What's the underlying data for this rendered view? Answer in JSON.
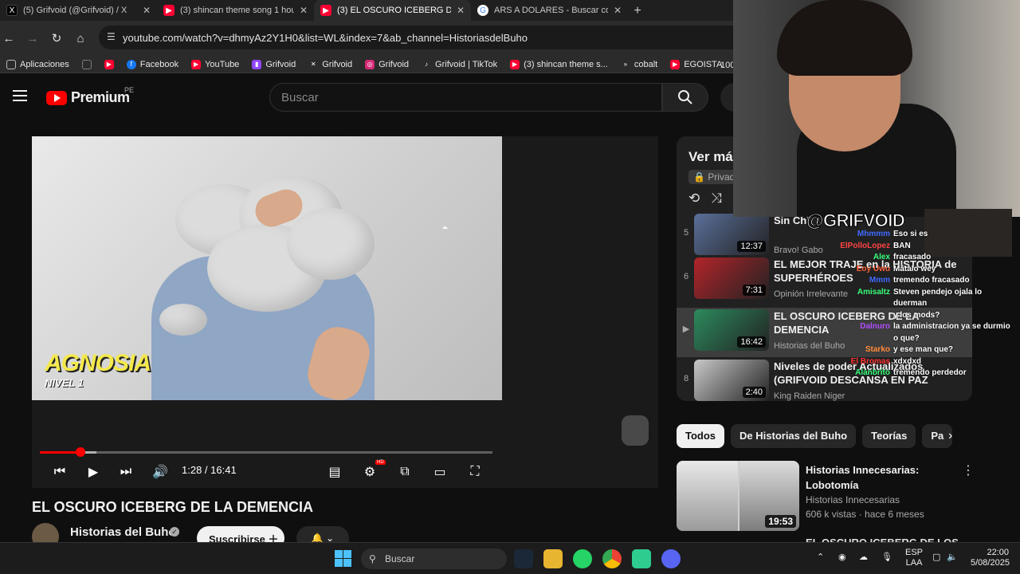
{
  "tabs": [
    {
      "title": "(5) Grifvoid (@Grifvoid) / X",
      "fav": "x-icon",
      "color": "#000000"
    },
    {
      "title": "(3) shincan theme song 1 hour",
      "fav": "youtube-icon",
      "color": "#ff0033"
    },
    {
      "title": "(3) EL OSCURO ICEBERG DE LA",
      "fav": "youtube-icon",
      "color": "#ff0033"
    },
    {
      "title": "ARS A DOLARES - Buscar con G",
      "fav": "google-icon",
      "color": "#4285f4"
    }
  ],
  "address": {
    "url": "youtube.com/watch?v=dhmyAz2Y1H0&list=WL&index=7&ab_channel=HistoriasdelBuho"
  },
  "bookmarks": [
    {
      "label": "Aplicaciones"
    },
    {
      "label": "Facebook"
    },
    {
      "label": "YouTube"
    },
    {
      "label": "Grifvoid"
    },
    {
      "label": "Grifvoid"
    },
    {
      "label": "Grifvoid"
    },
    {
      "label": "Grifvoid | TikTok"
    },
    {
      "label": "(3) shincan theme s..."
    },
    {
      "label": "cobalt"
    },
    {
      "label": "EGOISTA"
    }
  ],
  "zoom": "100",
  "header": {
    "logo": "Premium",
    "region": "PE",
    "search_placeholder": "Buscar"
  },
  "player": {
    "overlay_title": "AGNOSIA",
    "overlay_level": "NIVEL 1",
    "time": "1:28 / 16:41",
    "played_fraction": 0.089,
    "buffered_fraction": 0.125,
    "hd": "HD"
  },
  "video": {
    "title": "EL OSCURO ICEBERG DE LA DEMENCIA",
    "channel": "Historias del Buho",
    "subscribe": "Suscribirse"
  },
  "playlist": {
    "header": "Ver má",
    "privacy": "Privad",
    "items": [
      {
        "idx": "5",
        "title": "Sin Chi",
        "channel": "Bravo! Gabo",
        "dur": "12:37",
        "color": "#5a6f9a"
      },
      {
        "idx": "6",
        "title": "EL MEJOR TRAJE en la HISTORIA de SUPERHÉROES",
        "channel": "Opinión Irrelevante",
        "dur": "7:31",
        "color": "#b2242a"
      },
      {
        "idx": "▶",
        "title": "EL OSCURO ICEBERG DE LA DEMENCIA",
        "channel": "Historias del Buho",
        "dur": "16:42",
        "color": "#2c8a5e"
      },
      {
        "idx": "8",
        "title": "Niveles de poder Actualizados (GRIFVOID DESCANSA EN PAZ",
        "channel": "King Raiden Niger",
        "dur": "2:40",
        "color": "#c9c9c9"
      }
    ]
  },
  "chips": [
    "Todos",
    "De Historias del Buho",
    "Teorías",
    "Pa"
  ],
  "recommendation": {
    "title": "Historias Innecesarias: Lobotomía",
    "channel": "Historias Innecesarias",
    "stats": "606 k vistas · hace 6 meses",
    "dur": "19:53",
    "next_title": "EL OSCURO ICEBERG DE LOS"
  },
  "stream": {
    "handle": "@GRIFVOID",
    "chat": [
      {
        "user": "Mhmmm",
        "msg": "Eso si es",
        "color": "#3f6bff"
      },
      {
        "user": "ElPolloLopez",
        "msg": "BAN",
        "color": "#ff4444"
      },
      {
        "user": "Alex",
        "msg": "fracasado",
        "color": "#37ff7a"
      },
      {
        "user": "Eoy Uwu",
        "msg": "Mátalo wey",
        "color": "#ff5f3a"
      },
      {
        "user": "Mmm",
        "msg": "tremendo fracasado",
        "color": "#3f6bff"
      },
      {
        "user": "Amisaltz",
        "msg": "Steven pendejo ojala lo",
        "color": "#37ff7a"
      },
      {
        "user": "",
        "msg": "duerman",
        "color": "#ffffff"
      },
      {
        "user": "",
        "msg": "y los mods?",
        "color": "#ffffff"
      },
      {
        "user": "Dalnuro",
        "msg": "la administracion ya se durmio",
        "color": "#b04dff"
      },
      {
        "user": "",
        "msg": "o que?",
        "color": "#ffffff"
      },
      {
        "user": "Starko",
        "msg": "y ese man que?",
        "color": "#ff8a3a"
      },
      {
        "user": "El Bromas",
        "msg": "xdxdxd",
        "color": "#ff3030"
      },
      {
        "user": "Alanbrito",
        "msg": "tremendo perdedor",
        "color": "#37ff7a"
      }
    ]
  },
  "taskbar": {
    "search": "Buscar",
    "lang1": "ESP",
    "lang2": "LAA",
    "time": "22:00",
    "date": "5/08/2025"
  }
}
